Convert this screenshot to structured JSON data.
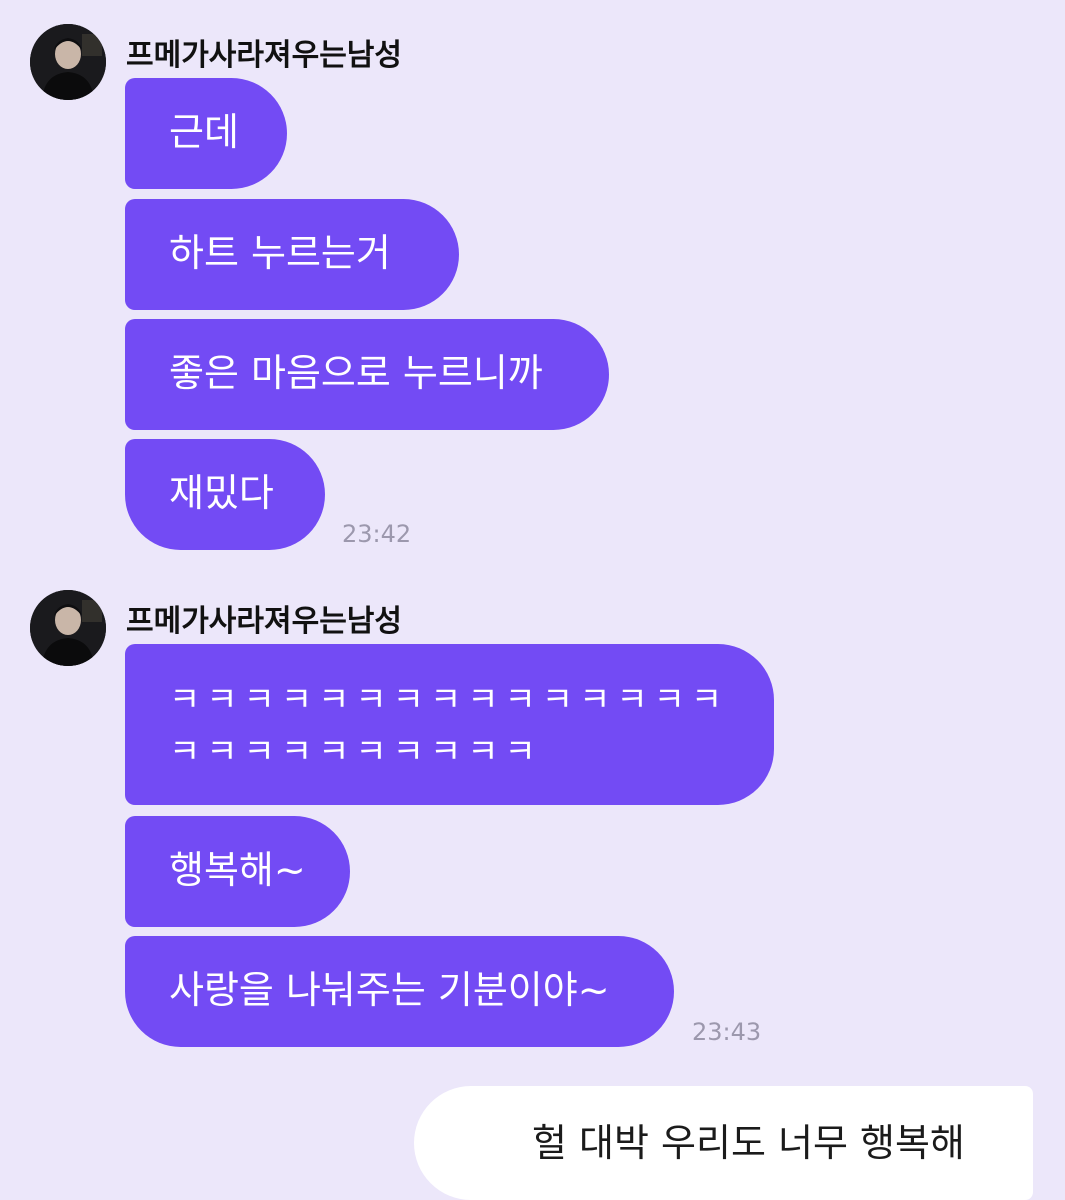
{
  "chat": {
    "groups": [
      {
        "sender": "프메가사라져우는남성",
        "messages": [
          "근데",
          "하트 누르는거",
          "좋은 마음으로 누르니까",
          "재밌다"
        ],
        "time": "23:42"
      },
      {
        "sender": "프메가사라져우는남성",
        "messages": [
          "ㅋㅋㅋㅋㅋㅋㅋㅋㅋㅋㅋㅋㅋㅋㅋㅋㅋㅋㅋㅋㅋㅋㅋㅋㅋ",
          "행복해~",
          "사랑을 나눠주는 기분이야~"
        ],
        "time": "23:43"
      }
    ],
    "my_message": "헐 대박 우리도 너무 행복해"
  },
  "colors": {
    "background": "#ECE7FA",
    "bubble": "#734BF4",
    "my_bubble": "#FFFFFF"
  }
}
